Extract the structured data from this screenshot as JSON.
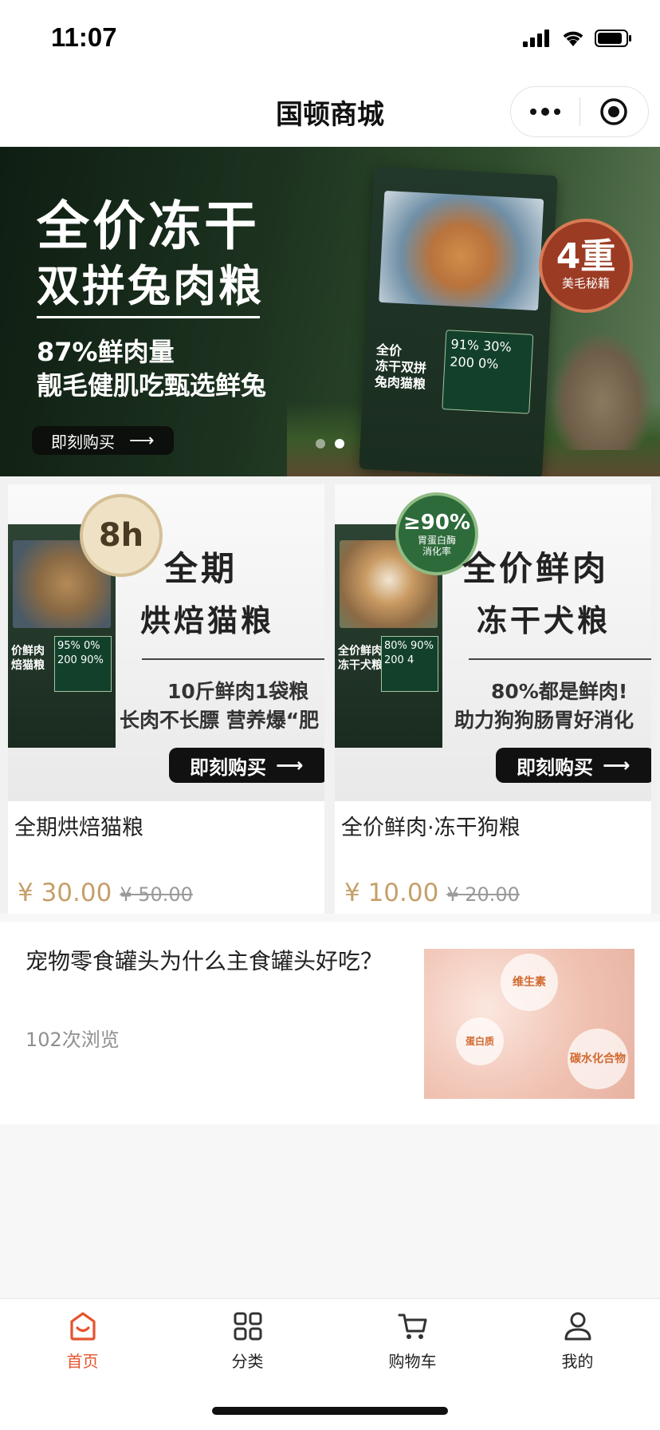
{
  "status_bar": {
    "time": "11:07"
  },
  "nav": {
    "title": "国顿商城"
  },
  "banner": {
    "headline": "全价冻干",
    "subheadline": "双拼兔肉粮",
    "stat": "87%鲜肉量",
    "description": "靓毛健肌吃甄选鲜兔",
    "button": "即刻购买",
    "bag_label": "全价\n冻干双拼\n兔肉猫粮",
    "bag_nums": "91% 30%\n200 0%",
    "seal_big": "4重",
    "seal_small": "美毛秘籍"
  },
  "products": [
    {
      "image_h1": "全期",
      "image_h2": "烘焙猫粮",
      "image_p1": "10斤鲜肉1袋粮",
      "image_p2": "长肉不长膘 营养爆“肥",
      "badge": "8h",
      "bag_text": "价鲜肉\n焙猫粮",
      "bag_nums": "95% 0%\n200 90%",
      "button": "即刻购买",
      "name": "全期烘焙猫粮",
      "price": "¥ 30.00",
      "original_price": "¥ 50.00"
    },
    {
      "image_h1": "全价鲜肉",
      "image_h2": "冻干犬粮",
      "image_p1": "80%都是鲜肉!",
      "image_p2": "助力狗狗肠胃好消化",
      "badge": "≥90%",
      "badge_sub": "胃蛋白酶\n消化率",
      "bag_text": "全价鲜肉\n冻干犬粮",
      "bag_nums": "80% 90%\n200 4",
      "button": "即刻购买",
      "name": "全价鲜肉·冻干狗粮",
      "price": "¥ 10.00",
      "original_price": "¥ 20.00"
    }
  ],
  "article": {
    "title": "宠物零食罐头为什么主食罐头好吃？",
    "views": "102次浏览",
    "thumb_tags": [
      "维生素",
      "蛋白质",
      "碳水化合物"
    ]
  },
  "tabs": [
    {
      "label": "首页",
      "icon": "home-icon",
      "active": true
    },
    {
      "label": "分类",
      "icon": "grid-icon",
      "active": false
    },
    {
      "label": "购物车",
      "icon": "cart-icon",
      "active": false
    },
    {
      "label": "我的",
      "icon": "user-icon",
      "active": false
    }
  ],
  "colors": {
    "accent": "#e4542c",
    "price": "#c5a06a",
    "banner_green": "#1d3320"
  }
}
